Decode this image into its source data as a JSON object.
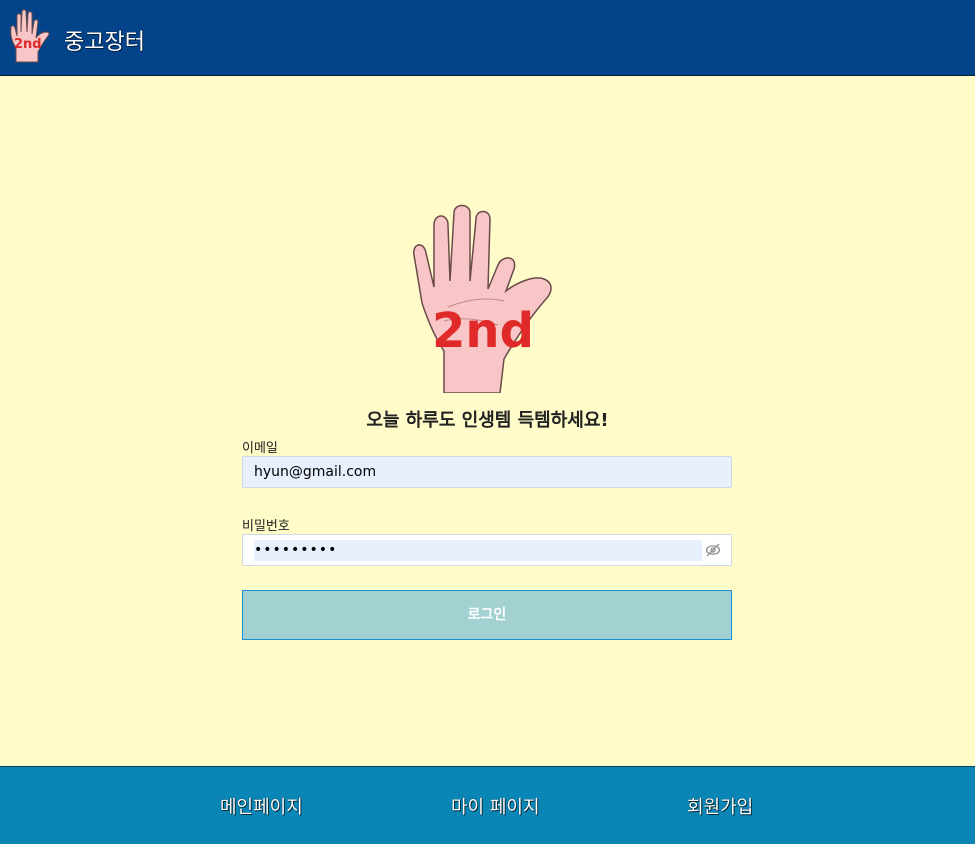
{
  "header": {
    "title": "중고장터",
    "logo_text": "2nd"
  },
  "hero": {
    "logo_text": "2nd"
  },
  "tagline": "오늘 하루도 인생템 득템하세요!",
  "form": {
    "email_label": "이메일",
    "email_value": "hyun@gmail.com",
    "password_label": "비밀번호",
    "password_value": "•••••••••",
    "login_label": "로그인"
  },
  "footer": {
    "items": [
      {
        "label": "메인페이지"
      },
      {
        "label": "마이 페이지"
      },
      {
        "label": "회원가입"
      }
    ]
  },
  "colors": {
    "header_bg": "#024389",
    "page_bg": "#fffcca",
    "footer_bg": "#0a86b6",
    "button_bg": "#a3d1d1",
    "logo_red": "#e02a2a"
  }
}
